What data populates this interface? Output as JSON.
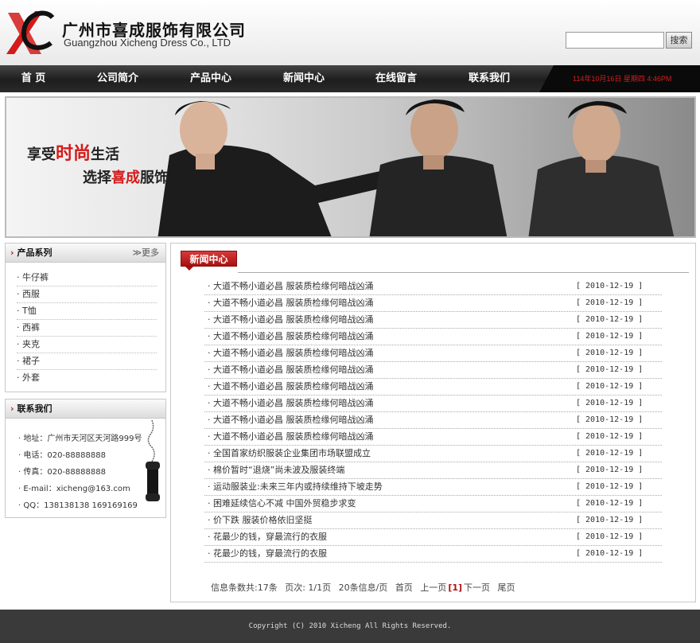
{
  "header": {
    "company_cn": "广州市喜成服饰有限公司",
    "company_en": "Guangzhou Xicheng Dress Co., LTD",
    "logo_letters": "XC",
    "search_value": "",
    "search_button": "搜索"
  },
  "nav": {
    "items": [
      "首 页",
      "公司简介",
      "产品中心",
      "新闻中心",
      "在线留言",
      "联系我们"
    ],
    "datetime": "114年10月16日  星期四  4:46PM"
  },
  "banner": {
    "slogan1_a": "享受",
    "slogan1_b": "时尚",
    "slogan1_c": "生活",
    "slogan2_a": "选择",
    "slogan2_b": "喜成",
    "slogan2_c": "服饰"
  },
  "sidebar": {
    "products_title": "产品系列",
    "more_label": "≫更多",
    "categories": [
      "牛仔裤",
      "西服",
      "T恤",
      "西裤",
      "夹克",
      "裙子",
      "外套"
    ],
    "contact_title": "联系我们",
    "contacts": [
      "地址：广州市天河区天河路999号",
      "电话：020-88888888",
      "传真：020-88888888",
      "E-mail：xicheng@163.com",
      "QQ：138138138 169169169"
    ]
  },
  "main": {
    "tab_title": "新闻中心",
    "news": [
      {
        "title": "大道不畅小道必昌  服装质检缘何暗战凶涌",
        "date": "[ 2010-12-19 ]"
      },
      {
        "title": "大道不畅小道必昌  服装质检缘何暗战凶涌",
        "date": "[ 2010-12-19 ]"
      },
      {
        "title": "大道不畅小道必昌  服装质检缘何暗战凶涌",
        "date": "[ 2010-12-19 ]"
      },
      {
        "title": "大道不畅小道必昌  服装质检缘何暗战凶涌",
        "date": "[ 2010-12-19 ]"
      },
      {
        "title": "大道不畅小道必昌  服装质检缘何暗战凶涌",
        "date": "[ 2010-12-19 ]"
      },
      {
        "title": "大道不畅小道必昌  服装质检缘何暗战凶涌",
        "date": "[ 2010-12-19 ]"
      },
      {
        "title": "大道不畅小道必昌  服装质检缘何暗战凶涌",
        "date": "[ 2010-12-19 ]"
      },
      {
        "title": "大道不畅小道必昌  服装质检缘何暗战凶涌",
        "date": "[ 2010-12-19 ]"
      },
      {
        "title": "大道不畅小道必昌  服装质检缘何暗战凶涌",
        "date": "[ 2010-12-19 ]"
      },
      {
        "title": "大道不畅小道必昌  服装质检缘何暗战凶涌",
        "date": "[ 2010-12-19 ]"
      },
      {
        "title": "全国首家纺织服装企业集团市场联盟成立",
        "date": "[ 2010-12-19 ]"
      },
      {
        "title": "棉价暂时“退烧”尚未波及服装终端",
        "date": "[ 2010-12-19 ]"
      },
      {
        "title": "运动服装业:未来三年内或持续维持下坡走势",
        "date": "[ 2010-12-19 ]"
      },
      {
        "title": "困难延续信心不减  中国外贸稳步求变",
        "date": "[ 2010-12-19 ]"
      },
      {
        "title": "价下跌  服装价格依旧坚挺",
        "date": "[ 2010-12-19 ]"
      },
      {
        "title": "花最少的钱，穿最流行的衣服",
        "date": "[ 2010-12-19 ]"
      },
      {
        "title": "花最少的钱，穿最流行的衣服",
        "date": "[ 2010-12-19 ]"
      }
    ],
    "pager": {
      "count": "信息条数共:17条",
      "pages": "页次: 1/1页",
      "per_page": "20条信息/页",
      "first": "首页",
      "prev": "上一页",
      "current": "[1]",
      "next": "下一页",
      "last": "尾页"
    }
  },
  "footer": {
    "copyright": "Copyright (C) 2010 Xicheng All Rights Reserved."
  },
  "colors": {
    "accent_red": "#d31b1b",
    "nav_bg": "#2a2a2a",
    "footer_bg": "#3a3a3a"
  }
}
